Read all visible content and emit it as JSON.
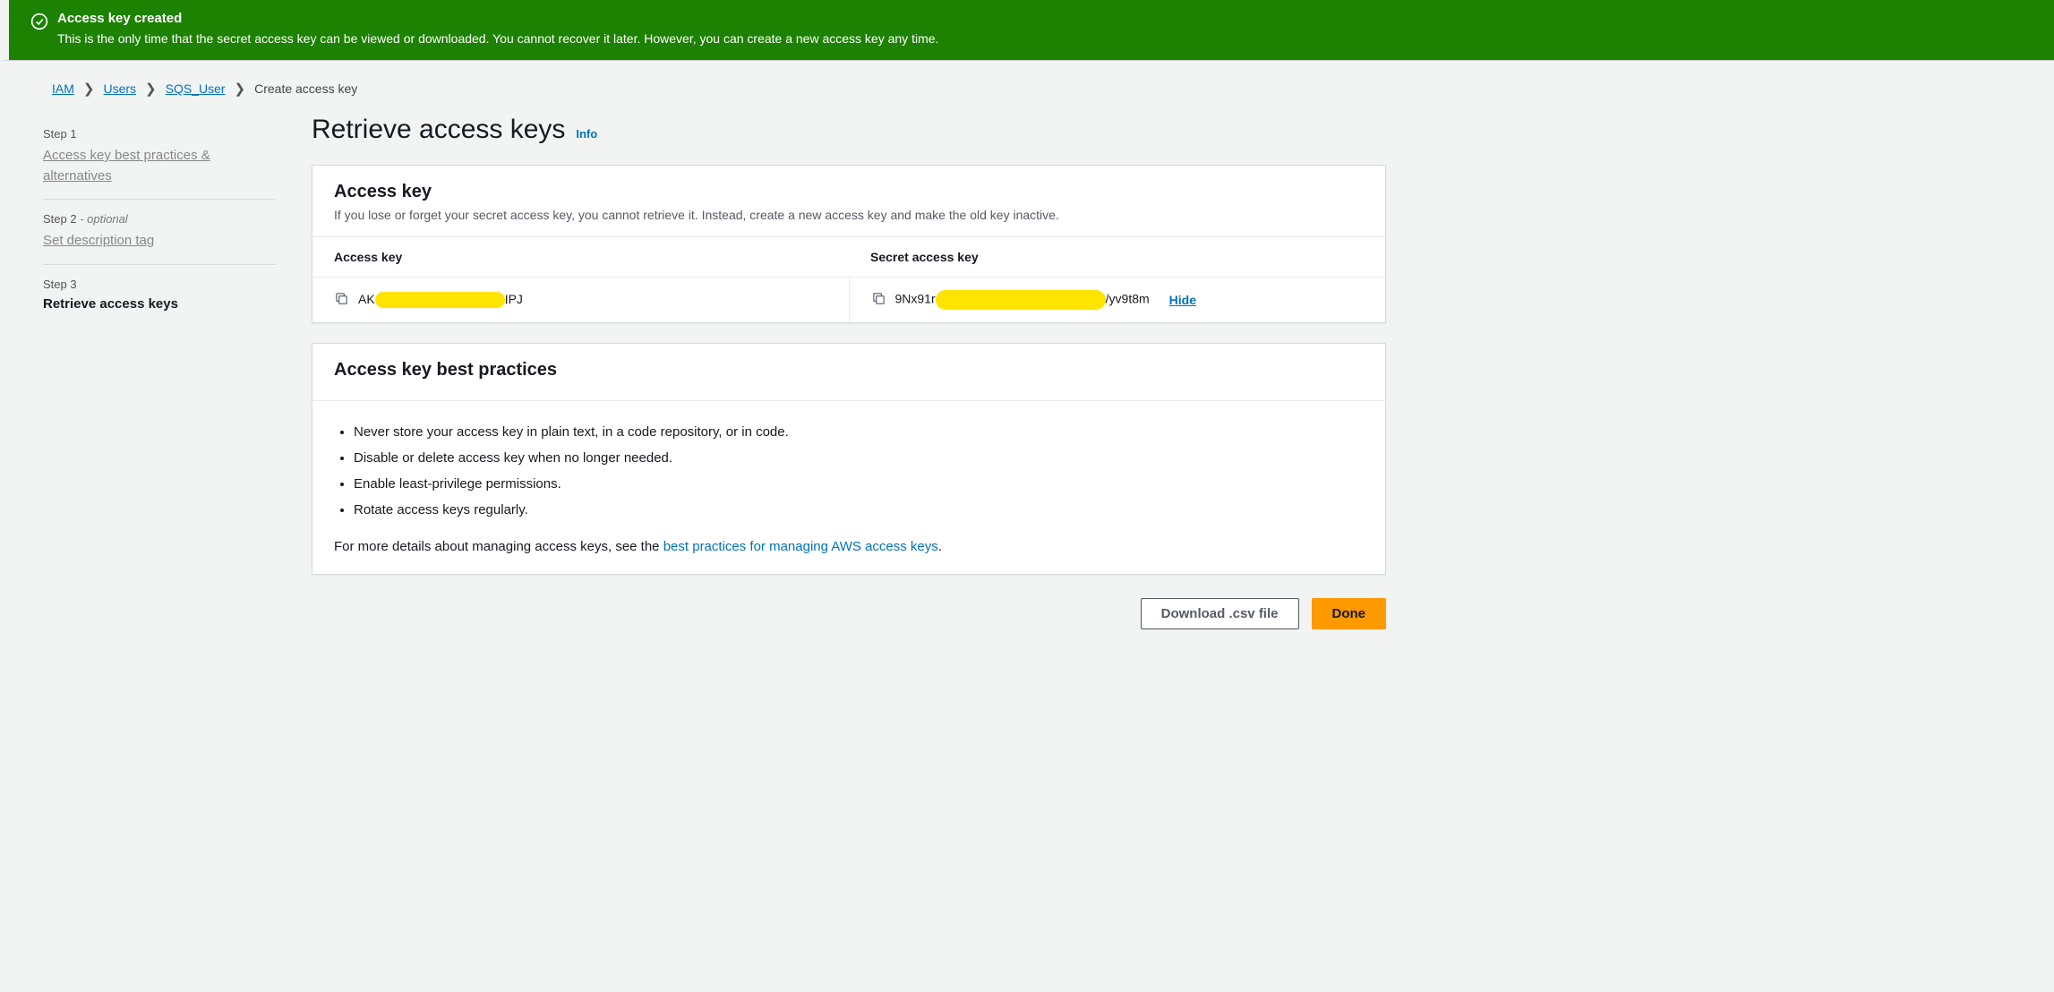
{
  "banner": {
    "title": "Access key created",
    "message": "This is the only time that the secret access key can be viewed or downloaded. You cannot recover it later. However, you can create a new access key any time."
  },
  "breadcrumbs": {
    "items": [
      "IAM",
      "Users",
      "SQS_User"
    ],
    "current": "Create access key"
  },
  "steps": {
    "s1_label": "Step 1",
    "s1_link": "Access key best practices & alternatives",
    "s2_label": "Step 2",
    "s2_opt": " - optional",
    "s2_link": "Set description tag",
    "s3_label": "Step 3",
    "s3_title": "Retrieve access keys"
  },
  "header": {
    "title": "Retrieve access keys",
    "info": "Info"
  },
  "accessKeyPanel": {
    "title": "Access key",
    "desc": "If you lose or forget your secret access key, you cannot retrieve it. Instead, create a new access key and make the old key inactive.",
    "col1": "Access key",
    "col2": "Secret access key",
    "key_prefix": "AK",
    "key_suffix": "IPJ",
    "secret_prefix": "9Nx91r",
    "secret_suffix": "/yv9t8m",
    "hide": "Hide"
  },
  "bestPractices": {
    "title": "Access key best practices",
    "items": [
      "Never store your access key in plain text, in a code repository, or in code.",
      "Disable or delete access key when no longer needed.",
      "Enable least-privilege permissions.",
      "Rotate access keys regularly."
    ],
    "more_prefix": "For more details about managing access keys, see the ",
    "more_link": "best practices for managing AWS access keys",
    "more_suffix": "."
  },
  "actions": {
    "download": "Download .csv file",
    "done": "Done"
  }
}
